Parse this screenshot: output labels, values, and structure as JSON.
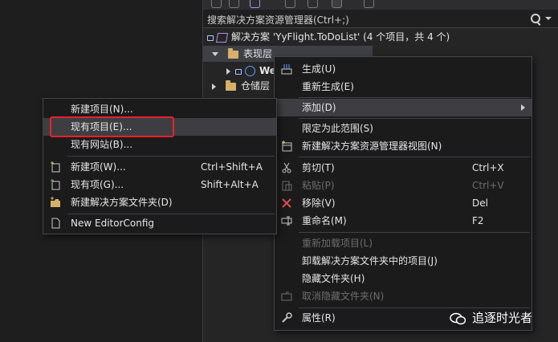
{
  "search": {
    "placeholder": "搜索解决方案资源管理器(Ctrl+;)"
  },
  "tree": {
    "solution_label": "解决方案 'YyFlight.ToDoList' (4 个项目，共 4 个)",
    "items": [
      {
        "label": "表现层"
      },
      {
        "label": "We"
      },
      {
        "label": "仓储层"
      }
    ]
  },
  "context_menu": {
    "items": [
      {
        "label": "生成(U)",
        "shortcut": ""
      },
      {
        "label": "重新生成(E)",
        "shortcut": ""
      },
      {
        "label": "添加(D)",
        "shortcut": ""
      },
      {
        "label": "限定为此范围(S)",
        "shortcut": ""
      },
      {
        "label": "新建解决方案资源管理器视图(N)",
        "shortcut": ""
      },
      {
        "label": "剪切(T)",
        "shortcut": "Ctrl+X"
      },
      {
        "label": "粘贴(P)",
        "shortcut": "Ctrl+V"
      },
      {
        "label": "移除(V)",
        "shortcut": "Del"
      },
      {
        "label": "重命名(M)",
        "shortcut": "F2"
      },
      {
        "label": "重新加载项目(L)",
        "shortcut": ""
      },
      {
        "label": "卸载解决方案文件夹中的项目(J)",
        "shortcut": ""
      },
      {
        "label": "隐藏文件夹(H)",
        "shortcut": ""
      },
      {
        "label": "取消隐藏文件夹(N)",
        "shortcut": ""
      },
      {
        "label": "属性(R)",
        "shortcut": ""
      }
    ]
  },
  "submenu": {
    "items": [
      {
        "label": "新建项目(N)...",
        "shortcut": ""
      },
      {
        "label": "现有项目(E)...",
        "shortcut": ""
      },
      {
        "label": "现有网站(B)...",
        "shortcut": ""
      },
      {
        "label": "新建项(W)...",
        "shortcut": "Ctrl+Shift+A"
      },
      {
        "label": "现有项(G)...",
        "shortcut": "Shift+Alt+A"
      },
      {
        "label": "新建解决方案文件夹(D)",
        "shortcut": ""
      },
      {
        "label": "New EditorConfig",
        "shortcut": ""
      }
    ]
  },
  "watermark": {
    "text": "追逐时光者"
  },
  "colors": {
    "highlight_box": "#e8202a",
    "menu_bg": "#1b1b1c",
    "explorer_bg": "#252526"
  }
}
